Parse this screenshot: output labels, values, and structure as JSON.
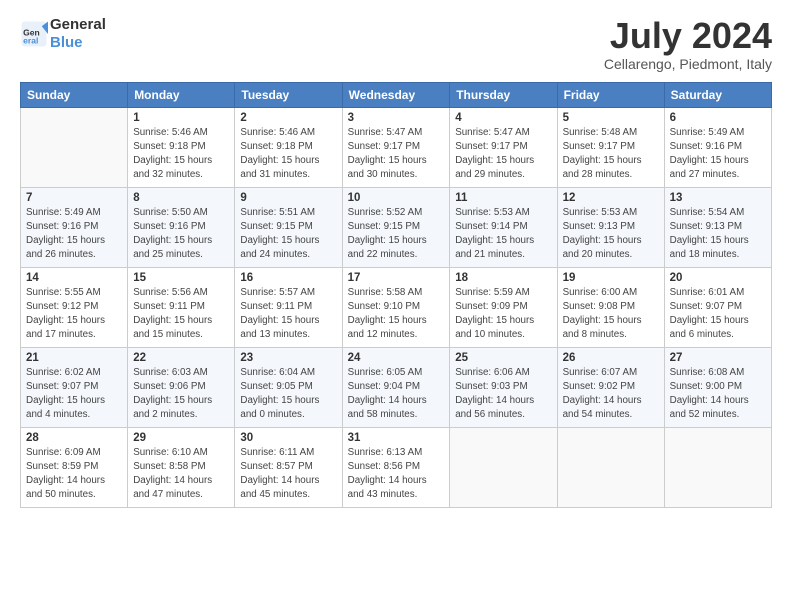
{
  "logo": {
    "line1": "General",
    "line2": "Blue"
  },
  "title": "July 2024",
  "location": "Cellarengo, Piedmont, Italy",
  "days_of_week": [
    "Sunday",
    "Monday",
    "Tuesday",
    "Wednesday",
    "Thursday",
    "Friday",
    "Saturday"
  ],
  "weeks": [
    [
      {
        "day": "",
        "info": ""
      },
      {
        "day": "1",
        "info": "Sunrise: 5:46 AM\nSunset: 9:18 PM\nDaylight: 15 hours\nand 32 minutes."
      },
      {
        "day": "2",
        "info": "Sunrise: 5:46 AM\nSunset: 9:18 PM\nDaylight: 15 hours\nand 31 minutes."
      },
      {
        "day": "3",
        "info": "Sunrise: 5:47 AM\nSunset: 9:17 PM\nDaylight: 15 hours\nand 30 minutes."
      },
      {
        "day": "4",
        "info": "Sunrise: 5:47 AM\nSunset: 9:17 PM\nDaylight: 15 hours\nand 29 minutes."
      },
      {
        "day": "5",
        "info": "Sunrise: 5:48 AM\nSunset: 9:17 PM\nDaylight: 15 hours\nand 28 minutes."
      },
      {
        "day": "6",
        "info": "Sunrise: 5:49 AM\nSunset: 9:16 PM\nDaylight: 15 hours\nand 27 minutes."
      }
    ],
    [
      {
        "day": "7",
        "info": "Sunrise: 5:49 AM\nSunset: 9:16 PM\nDaylight: 15 hours\nand 26 minutes."
      },
      {
        "day": "8",
        "info": "Sunrise: 5:50 AM\nSunset: 9:16 PM\nDaylight: 15 hours\nand 25 minutes."
      },
      {
        "day": "9",
        "info": "Sunrise: 5:51 AM\nSunset: 9:15 PM\nDaylight: 15 hours\nand 24 minutes."
      },
      {
        "day": "10",
        "info": "Sunrise: 5:52 AM\nSunset: 9:15 PM\nDaylight: 15 hours\nand 22 minutes."
      },
      {
        "day": "11",
        "info": "Sunrise: 5:53 AM\nSunset: 9:14 PM\nDaylight: 15 hours\nand 21 minutes."
      },
      {
        "day": "12",
        "info": "Sunrise: 5:53 AM\nSunset: 9:13 PM\nDaylight: 15 hours\nand 20 minutes."
      },
      {
        "day": "13",
        "info": "Sunrise: 5:54 AM\nSunset: 9:13 PM\nDaylight: 15 hours\nand 18 minutes."
      }
    ],
    [
      {
        "day": "14",
        "info": "Sunrise: 5:55 AM\nSunset: 9:12 PM\nDaylight: 15 hours\nand 17 minutes."
      },
      {
        "day": "15",
        "info": "Sunrise: 5:56 AM\nSunset: 9:11 PM\nDaylight: 15 hours\nand 15 minutes."
      },
      {
        "day": "16",
        "info": "Sunrise: 5:57 AM\nSunset: 9:11 PM\nDaylight: 15 hours\nand 13 minutes."
      },
      {
        "day": "17",
        "info": "Sunrise: 5:58 AM\nSunset: 9:10 PM\nDaylight: 15 hours\nand 12 minutes."
      },
      {
        "day": "18",
        "info": "Sunrise: 5:59 AM\nSunset: 9:09 PM\nDaylight: 15 hours\nand 10 minutes."
      },
      {
        "day": "19",
        "info": "Sunrise: 6:00 AM\nSunset: 9:08 PM\nDaylight: 15 hours\nand 8 minutes."
      },
      {
        "day": "20",
        "info": "Sunrise: 6:01 AM\nSunset: 9:07 PM\nDaylight: 15 hours\nand 6 minutes."
      }
    ],
    [
      {
        "day": "21",
        "info": "Sunrise: 6:02 AM\nSunset: 9:07 PM\nDaylight: 15 hours\nand 4 minutes."
      },
      {
        "day": "22",
        "info": "Sunrise: 6:03 AM\nSunset: 9:06 PM\nDaylight: 15 hours\nand 2 minutes."
      },
      {
        "day": "23",
        "info": "Sunrise: 6:04 AM\nSunset: 9:05 PM\nDaylight: 15 hours\nand 0 minutes."
      },
      {
        "day": "24",
        "info": "Sunrise: 6:05 AM\nSunset: 9:04 PM\nDaylight: 14 hours\nand 58 minutes."
      },
      {
        "day": "25",
        "info": "Sunrise: 6:06 AM\nSunset: 9:03 PM\nDaylight: 14 hours\nand 56 minutes."
      },
      {
        "day": "26",
        "info": "Sunrise: 6:07 AM\nSunset: 9:02 PM\nDaylight: 14 hours\nand 54 minutes."
      },
      {
        "day": "27",
        "info": "Sunrise: 6:08 AM\nSunset: 9:00 PM\nDaylight: 14 hours\nand 52 minutes."
      }
    ],
    [
      {
        "day": "28",
        "info": "Sunrise: 6:09 AM\nSunset: 8:59 PM\nDaylight: 14 hours\nand 50 minutes."
      },
      {
        "day": "29",
        "info": "Sunrise: 6:10 AM\nSunset: 8:58 PM\nDaylight: 14 hours\nand 47 minutes."
      },
      {
        "day": "30",
        "info": "Sunrise: 6:11 AM\nSunset: 8:57 PM\nDaylight: 14 hours\nand 45 minutes."
      },
      {
        "day": "31",
        "info": "Sunrise: 6:13 AM\nSunset: 8:56 PM\nDaylight: 14 hours\nand 43 minutes."
      },
      {
        "day": "",
        "info": ""
      },
      {
        "day": "",
        "info": ""
      },
      {
        "day": "",
        "info": ""
      }
    ]
  ]
}
